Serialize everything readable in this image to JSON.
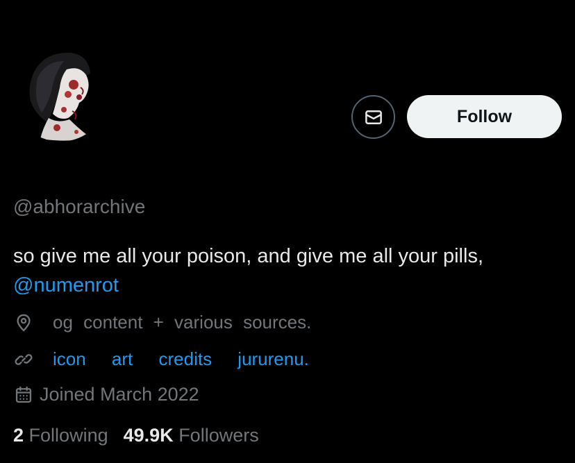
{
  "profile": {
    "handle": "@abhorarchive",
    "bio_text": "so give me all your poison, and give me all your pills,",
    "bio_mention": "@numenrot",
    "location": "og content + various sources.",
    "website": "icon art credits jururenu.",
    "joined": "Joined March 2022"
  },
  "actions": {
    "follow_label": "Follow",
    "message_icon": "mail-icon"
  },
  "stats": {
    "following_count": "2",
    "following_label": "Following",
    "followers_count": "49.9K",
    "followers_label": "Followers"
  },
  "colors": {
    "background": "#000000",
    "primary_text": "#e7e9ea",
    "secondary_text": "#71767b",
    "link": "#1d9bf0",
    "follow_button_bg": "#eff3f4"
  },
  "icons": {
    "location": "location-pin-icon",
    "website": "link-icon",
    "joined": "calendar-icon"
  }
}
